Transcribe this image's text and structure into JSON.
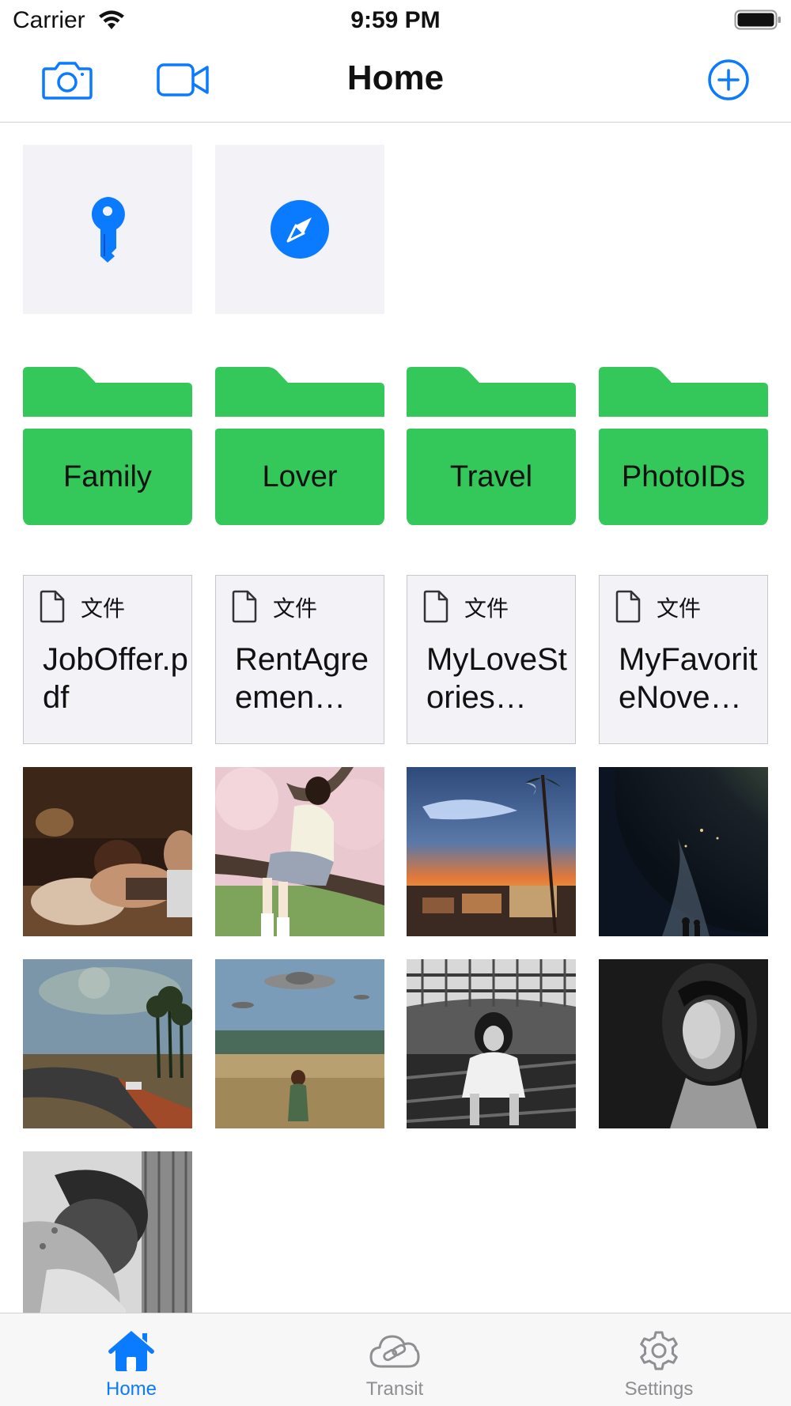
{
  "status_bar": {
    "carrier": "Carrier",
    "time": "9:59 PM"
  },
  "nav": {
    "title": "Home",
    "left_icons": [
      "camera-icon",
      "video-camera-icon"
    ],
    "right_icon": "plus-circle-icon"
  },
  "quick_actions": [
    {
      "icon": "key-icon"
    },
    {
      "icon": "compass-icon"
    }
  ],
  "folders": [
    {
      "label": "Family"
    },
    {
      "label": "Lover"
    },
    {
      "label": "Travel"
    },
    {
      "label": "PhotoIDs"
    }
  ],
  "files": [
    {
      "type_label": "文件",
      "name": "JobOffer.pdf",
      "display_name": "JobOffer\n.pdf"
    },
    {
      "type_label": "文件",
      "name": "RentAgreemen…",
      "display_name": "RentAgr\neemen…"
    },
    {
      "type_label": "文件",
      "name": "MyLoveStories…",
      "display_name": "MyLove\nStories…"
    },
    {
      "type_label": "文件",
      "name": "MyFavoriteNove…",
      "display_name": "MyFavori\nteNove…"
    }
  ],
  "photos": [
    {
      "subject": "woman reading in bed"
    },
    {
      "subject": "girl sitting in cherry blossom tree"
    },
    {
      "subject": "sunset coastal town with whale in sky"
    },
    {
      "subject": "earth from space with figures"
    },
    {
      "subject": "coastal road with palm trees and planet"
    },
    {
      "subject": "woman in field with UFOs"
    },
    {
      "subject": "black and white girl on roof"
    },
    {
      "subject": "black and white portrait"
    },
    {
      "subject": "black and white curled figure"
    }
  ],
  "tab_bar": {
    "tabs": [
      {
        "label": "Home",
        "icon": "house-icon",
        "selected": true
      },
      {
        "label": "Transit",
        "icon": "cloud-link-icon",
        "selected": false
      },
      {
        "label": "Settings",
        "icon": "gear-icon",
        "selected": false
      }
    ]
  },
  "colors": {
    "accent": "#0a7aff",
    "folder_green": "#34c759",
    "tile_bg": "#f2f2f7",
    "inactive_gray": "#8e8e93"
  }
}
